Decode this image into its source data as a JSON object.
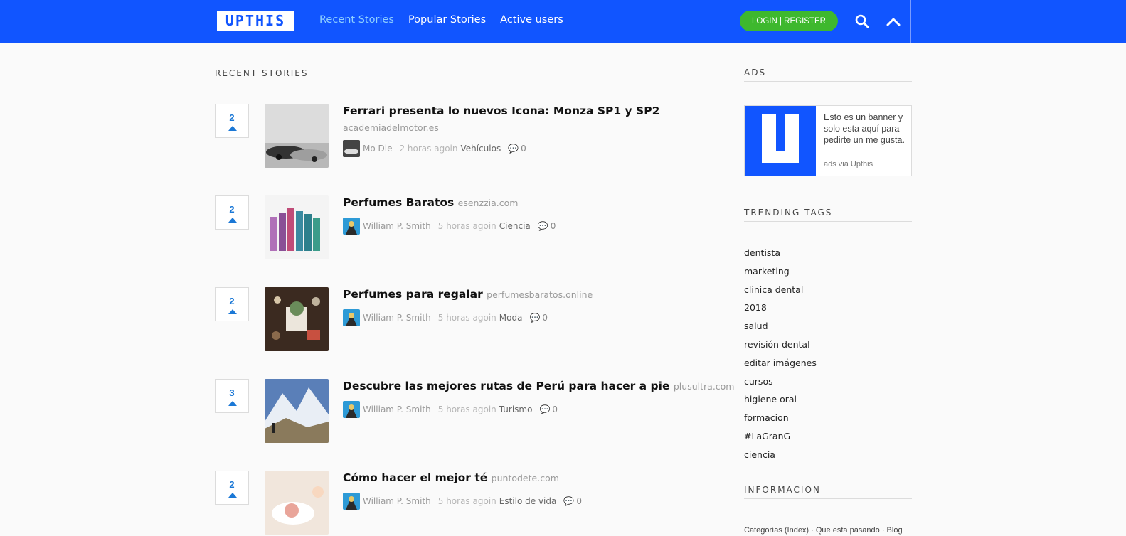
{
  "header": {
    "logo": "UPTHIS",
    "nav": [
      "Recent Stories",
      "Popular Stories",
      "Active users"
    ],
    "login_label": "LOGIN | REGISTER",
    "accent": "#1155ff",
    "login_color": "#3eb82e"
  },
  "recent": {
    "title": "RECENT STORIES",
    "stories": [
      {
        "votes": "2",
        "title": "Ferrari presenta lo nuevos Icona: Monza SP1 y SP2",
        "domain": "academiadelmotor.es",
        "author": "Mo Die",
        "time": "2 horas agoin",
        "category": "Vehículos",
        "comments": "0"
      },
      {
        "votes": "2",
        "title": "Perfumes Baratos",
        "domain": "esenzzia.com",
        "author": "William P. Smith",
        "time": "5 horas agoin",
        "category": "Ciencia",
        "comments": "0"
      },
      {
        "votes": "2",
        "title": "Perfumes para regalar",
        "domain": "perfumesbaratos.online",
        "author": "William P. Smith",
        "time": "5 horas agoin",
        "category": "Moda",
        "comments": "0"
      },
      {
        "votes": "3",
        "title": "Descubre las mejores rutas de Perú para hacer a pie",
        "domain": "plusultra.com",
        "author": "William P. Smith",
        "time": "5 horas agoin",
        "category": "Turismo",
        "comments": "0"
      },
      {
        "votes": "2",
        "title": "Cómo hacer el mejor té",
        "domain": "puntodete.com",
        "author": "William P. Smith",
        "time": "5 horas agoin",
        "category": "Estilo de vida",
        "comments": "0"
      }
    ]
  },
  "sidebar": {
    "ads_title": "ADS",
    "ad_text": "Esto es un banner y solo esta aquí para pedirte un me gusta.",
    "ad_via": "ads via Upthis",
    "tags_title": "TRENDING TAGS",
    "tags": [
      "dentista",
      "marketing",
      "clinica dental",
      "2018",
      "salud",
      "revisión dental",
      "editar imágenes",
      "cursos",
      "higiene oral",
      "formacion",
      "#LaGranG",
      "ciencia"
    ],
    "info_title": "INFORMACION",
    "info_links": "Categorías (Index) · Que esta pasando · Blog"
  }
}
